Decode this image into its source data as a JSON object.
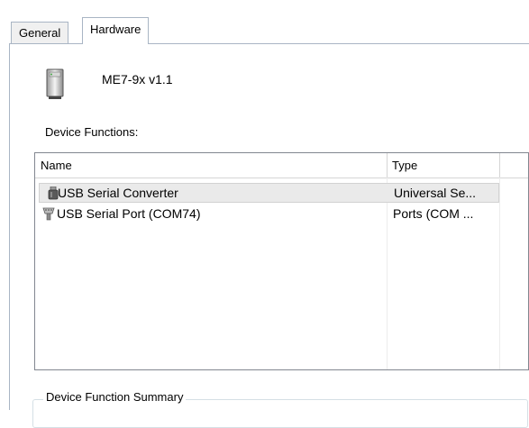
{
  "tabs": [
    {
      "label": "General",
      "active": false
    },
    {
      "label": "Hardware",
      "active": true
    }
  ],
  "device": {
    "name": "ME7-9x v1.1",
    "icon": "device-tower-icon"
  },
  "device_functions": {
    "label": "Device Functions:",
    "columns": [
      "Name",
      "Type"
    ],
    "rows": [
      {
        "name": "USB Serial Converter",
        "type": "Universal Se...",
        "icon": "usb-plug-icon",
        "selected": true
      },
      {
        "name": "USB Serial Port (COM74)",
        "type": "Ports (COM ...",
        "icon": "serial-port-icon",
        "selected": false
      }
    ]
  },
  "summary": {
    "label": "Device Function Summary"
  }
}
